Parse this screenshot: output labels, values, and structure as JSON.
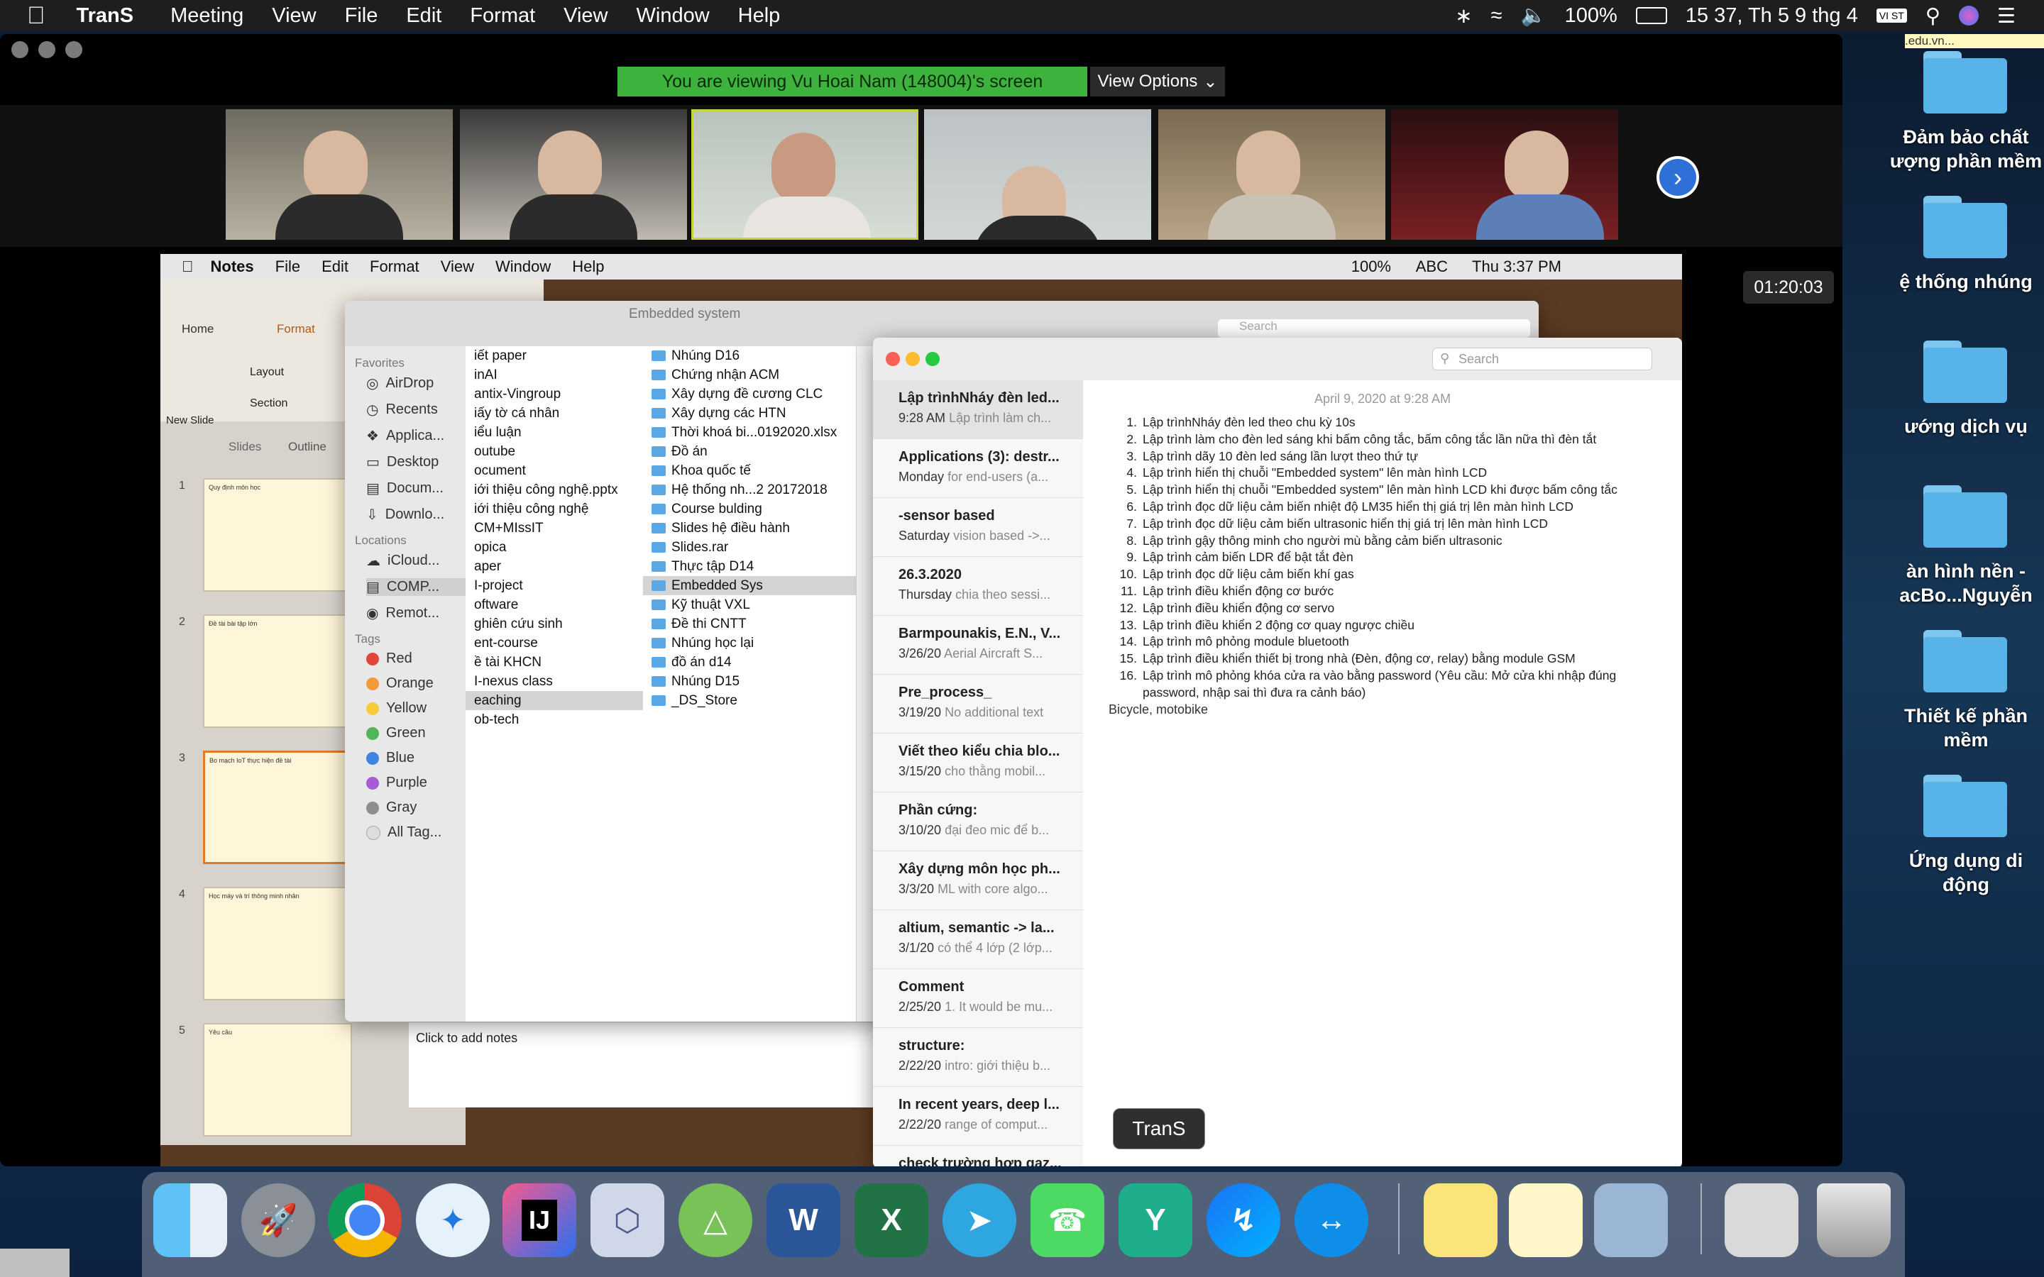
{
  "menubar": {
    "app": "TranS",
    "items": [
      "Meeting",
      "View",
      "File",
      "Edit",
      "Format",
      "View",
      "Window",
      "Help"
    ],
    "battery": "100%",
    "clock": "15 37, Th 5 9 thg 4",
    "input": "VI ST"
  },
  "zoom": {
    "banner": "You are viewing Vu Hoai Nam (148004)'s screen",
    "view_options": "View Options",
    "timer": "01:20:03"
  },
  "inner": {
    "app": "Notes",
    "items": [
      "File",
      "Edit",
      "Format",
      "View",
      "Window",
      "Help"
    ],
    "battery": "100%",
    "input": "ABC",
    "clock": "Thu 3:37 PM"
  },
  "ppt": {
    "tabs": [
      "Home",
      "Format"
    ],
    "new_slide": "New Slide",
    "layout": "Layout",
    "section": "Section",
    "slides_tab": "Slides",
    "outline_tab": "Outline",
    "notes_placeholder": "Click to add notes",
    "slide_numbers": [
      "1",
      "2",
      "3",
      "4",
      "5"
    ],
    "slide_titles": [
      "Quy định môn học",
      "Đề tài bài tập lớn",
      "Bo mạch IoT thực hiện đề tài",
      "Học máy và trí thông minh nhân",
      "Yêu cầu"
    ]
  },
  "finder": {
    "window_title": "Embedded system",
    "search": "Search",
    "sidebar": {
      "favorites_header": "Favorites",
      "favorites": [
        "AirDrop",
        "Recents",
        "Applica...",
        "Desktop",
        "Docum...",
        "Downlo..."
      ],
      "locations_header": "Locations",
      "locations": [
        "iCloud...",
        "COMP...",
        "Remot..."
      ],
      "tags_header": "Tags",
      "tags": [
        {
          "name": "Red",
          "color": "#e2453c"
        },
        {
          "name": "Orange",
          "color": "#f29a38"
        },
        {
          "name": "Yellow",
          "color": "#f5cc3a"
        },
        {
          "name": "Green",
          "color": "#52b55a"
        },
        {
          "name": "Blue",
          "color": "#3f83e6"
        },
        {
          "name": "Purple",
          "color": "#a45bd6"
        },
        {
          "name": "Gray",
          "color": "#8e8e8e"
        },
        {
          "name": "All Tag...",
          "color": "#dddddd"
        }
      ]
    },
    "col1": [
      "iết paper",
      "inAI",
      "antix-Vingroup",
      "iấy tờ cá nhân",
      "iểu luận",
      "outube",
      "ocument",
      "iới thiệu công nghệ.pptx",
      "iới thiệu công nghệ",
      "CM+MIssIT",
      "opica",
      "aper",
      "I-project",
      "oftware",
      "ghiên cứu sinh",
      "ent-course",
      "ề tài KHCN",
      "I-nexus class",
      "eaching",
      "ob-tech"
    ],
    "col2": [
      "Nhúng D16",
      "Chứng nhận ACM",
      "Xây dựng đề cương CLC",
      "Xây dựng các HTN",
      "Thời khoá bi...0192020.xlsx",
      "Đồ án",
      "Khoa quốc tế",
      "Hệ thống nh...2 20172018",
      "Course bulding",
      "Slides hệ điều hành",
      "Slides.rar",
      "Thực tập D14",
      "Embedded Sys",
      "Kỹ thuật VXL",
      "Đề thi CNTT",
      "Nhúng học lại",
      "đồ án d14",
      "Nhúng D15",
      "_DS_Store"
    ]
  },
  "notes": {
    "search": "Search",
    "list": [
      {
        "title": "Lập trìnhNháy đèn led...",
        "date": "9:28 AM",
        "snippet": "Lập trình làm ch..."
      },
      {
        "title": "Applications (3): destr...",
        "date": "Monday",
        "snippet": "for end-users (a..."
      },
      {
        "title": "-sensor based",
        "date": "Saturday",
        "snippet": "vision based ->..."
      },
      {
        "title": "26.3.2020",
        "date": "Thursday",
        "snippet": "chia theo sessi..."
      },
      {
        "title": "Barmpounakis, E.N., V...",
        "date": "3/26/20",
        "snippet": "Aerial Aircraft S..."
      },
      {
        "title": "Pre_process_",
        "date": "3/19/20",
        "snippet": "No additional text"
      },
      {
        "title": "Viết theo kiểu chia blo...",
        "date": "3/15/20",
        "snippet": "cho thằng mobil..."
      },
      {
        "title": "Phần cứng:",
        "date": "3/10/20",
        "snippet": "đại đeo mic để b..."
      },
      {
        "title": "Xây dựng môn học ph...",
        "date": "3/3/20",
        "snippet": "ML with core algo..."
      },
      {
        "title": "altium, semantic -> la...",
        "date": "3/1/20",
        "snippet": "có thể 4 lớp (2 lớp..."
      },
      {
        "title": "Comment",
        "date": "2/25/20",
        "snippet": "1. It would be mu..."
      },
      {
        "title": "structure:",
        "date": "2/22/20",
        "snippet": "intro: giới thiệu b..."
      },
      {
        "title": "In recent years, deep l...",
        "date": "2/22/20",
        "snippet": "range of comput..."
      },
      {
        "title": "check trường hợp gaz...",
        "date": "",
        "snippet": ""
      }
    ],
    "date": "April 9, 2020 at 9:28 AM",
    "lines": [
      "Lập trìnhNháy đèn led theo chu kỳ 10s",
      "Lập trình làm cho đèn led sáng khi bấm công tắc, bấm công tắc lần nữa thì đèn tắt",
      "Lập trình dãy 10 đèn led sáng lần lượt theo thứ tự",
      "Lập trình hiển thị chuỗi \"Embedded system\" lên màn hình LCD",
      "Lập trình hiển thị chuỗi \"Embedded system\" lên màn hình LCD khi được bấm công tắc",
      "Lập trình đọc dữ liệu cảm biến nhiệt độ LM35 hiển thị giá trị lên màn hình LCD",
      "Lập trình đọc dữ liệu cảm biến ultrasonic hiển thị giá trị lên màn hình LCD",
      "Lập trình gậy thông minh cho người mù bằng cảm biến ultrasonic",
      "Lập trình cảm biến LDR để bật tắt đèn",
      "Lập trình đọc dữ liệu cảm biến khí gas",
      "Lập trình điều khiển động cơ bước",
      "Lập trình điều khiển động cơ servo",
      "Lập trình điều khiển 2 động cơ quay ngược chiều",
      "Lập trình mô phỏng module bluetooth",
      "Lập trình điều khiển thiết bị trong nhà (Đèn, động cơ, relay) bằng module GSM",
      "Lập trình mô phỏng khóa cửa ra vào bằng password (Yêu cầu: Mở cửa khi nhập đúng password, nhập sai thì đưa ra cảnh báo)"
    ],
    "footer": "Bicycle, motobike"
  },
  "desktop": {
    "url_snippet": ".edu.vn...",
    "labels": [
      "Đảm bảo chất\nượng phần mềm",
      "ệ thống nhúng",
      "ướng dịch vụ",
      "àn hình nền -\nacBo...Nguyễn",
      "Thiết kế phần\nmềm",
      "Ứng dụng di\nđộng"
    ]
  },
  "dock": {
    "tooltip": "TranS",
    "apps": [
      "Finder",
      "Launchpad",
      "Chrome",
      "Safari",
      "IntelliJ",
      "Box",
      "Android Studio",
      "Word",
      "Excel",
      "Telegram",
      "FaceTime",
      "TranS",
      "Messenger",
      "TeamViewer",
      "Stickies",
      "Notes",
      "Preview",
      "Screenshot",
      "Trash"
    ],
    "word_letter": "W",
    "excel_letter": "X",
    "ij_letter": "IJ"
  },
  "colors": {
    "banner": "#3db23d",
    "accent": "#2f6fd8"
  }
}
